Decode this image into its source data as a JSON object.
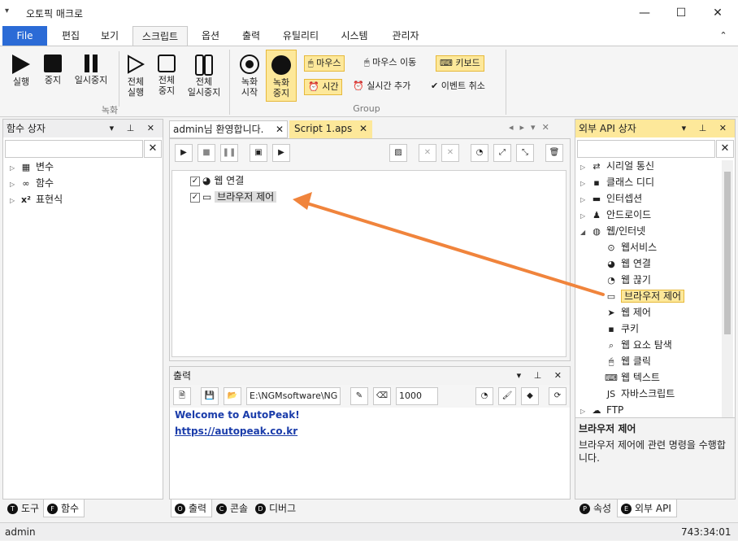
{
  "window": {
    "title": "오토픽 매크로",
    "menu_glyph": "▾",
    "minimize": "—",
    "maximize": "☐",
    "close": "✕"
  },
  "menu": {
    "tabs": [
      "File",
      "편집",
      "보기",
      "스크립트",
      "옵션",
      "출력",
      "유틸리티",
      "시스템",
      "관리자"
    ],
    "collapse": "⌃"
  },
  "ribbon": {
    "run": "실행",
    "stop": "중지",
    "pause": "일시중지",
    "run_all_1": "전체",
    "run_all_2": "실행",
    "stop_all_1": "전체",
    "stop_all_2": "중지",
    "pause_all_1": "전체",
    "pause_all_2": "일시중지",
    "rec_start_1": "녹화",
    "rec_start_2": "시작",
    "rec_stop_1": "녹화",
    "rec_stop_2": "중지",
    "mouse": "마우스",
    "mouse_move": "마우스 이동",
    "keyboard": "키보드",
    "time": "시간",
    "realtime_add": "실시간 추가",
    "event_cancel": "이벤트 취소",
    "group1_label": "녹화",
    "group2_label": "Group"
  },
  "left_panel": {
    "title": "함수 상자",
    "items": [
      "변수",
      "함수",
      "표현식"
    ],
    "tabs": [
      "도구",
      "함수"
    ]
  },
  "editor": {
    "tabs": [
      "admin님 환영합니다.",
      "Script 1.aps"
    ],
    "lines": [
      "웹 연결",
      "브라우저 제어"
    ]
  },
  "output": {
    "title": "출력",
    "path": "E:\\NGMsoftware\\NG",
    "number": "1000",
    "welcome": "Welcome to AutoPeak!",
    "link": "https://autopeak.co.kr",
    "tabs": [
      "출력",
      "콘솔",
      "디버그"
    ]
  },
  "right_panel": {
    "title": "외부 API 상자",
    "items": [
      "시리얼 통신",
      "클래스 디디",
      "인터셉션",
      "안드로이드",
      "웹/인터넷"
    ],
    "subitems": [
      "웹서비스",
      "웹 연결",
      "웹 끊기",
      "브라우저 제어",
      "웹 제어",
      "쿠키",
      "웹 요소 탐색",
      "웹 클릭",
      "웹 텍스트",
      "자바스크립트"
    ],
    "ftp": "FTP",
    "desc_title": "브라우저 제어",
    "desc_text": "브라우저 제어에 관련 명령을 수행합니다.",
    "tabs": [
      "속성",
      "외부 API"
    ]
  },
  "status": {
    "user": "admin",
    "time": "743:34:01"
  },
  "colors": {
    "accent": "#2b6bd6",
    "highlight": "#fde89a",
    "arrow": "#f0843c"
  }
}
